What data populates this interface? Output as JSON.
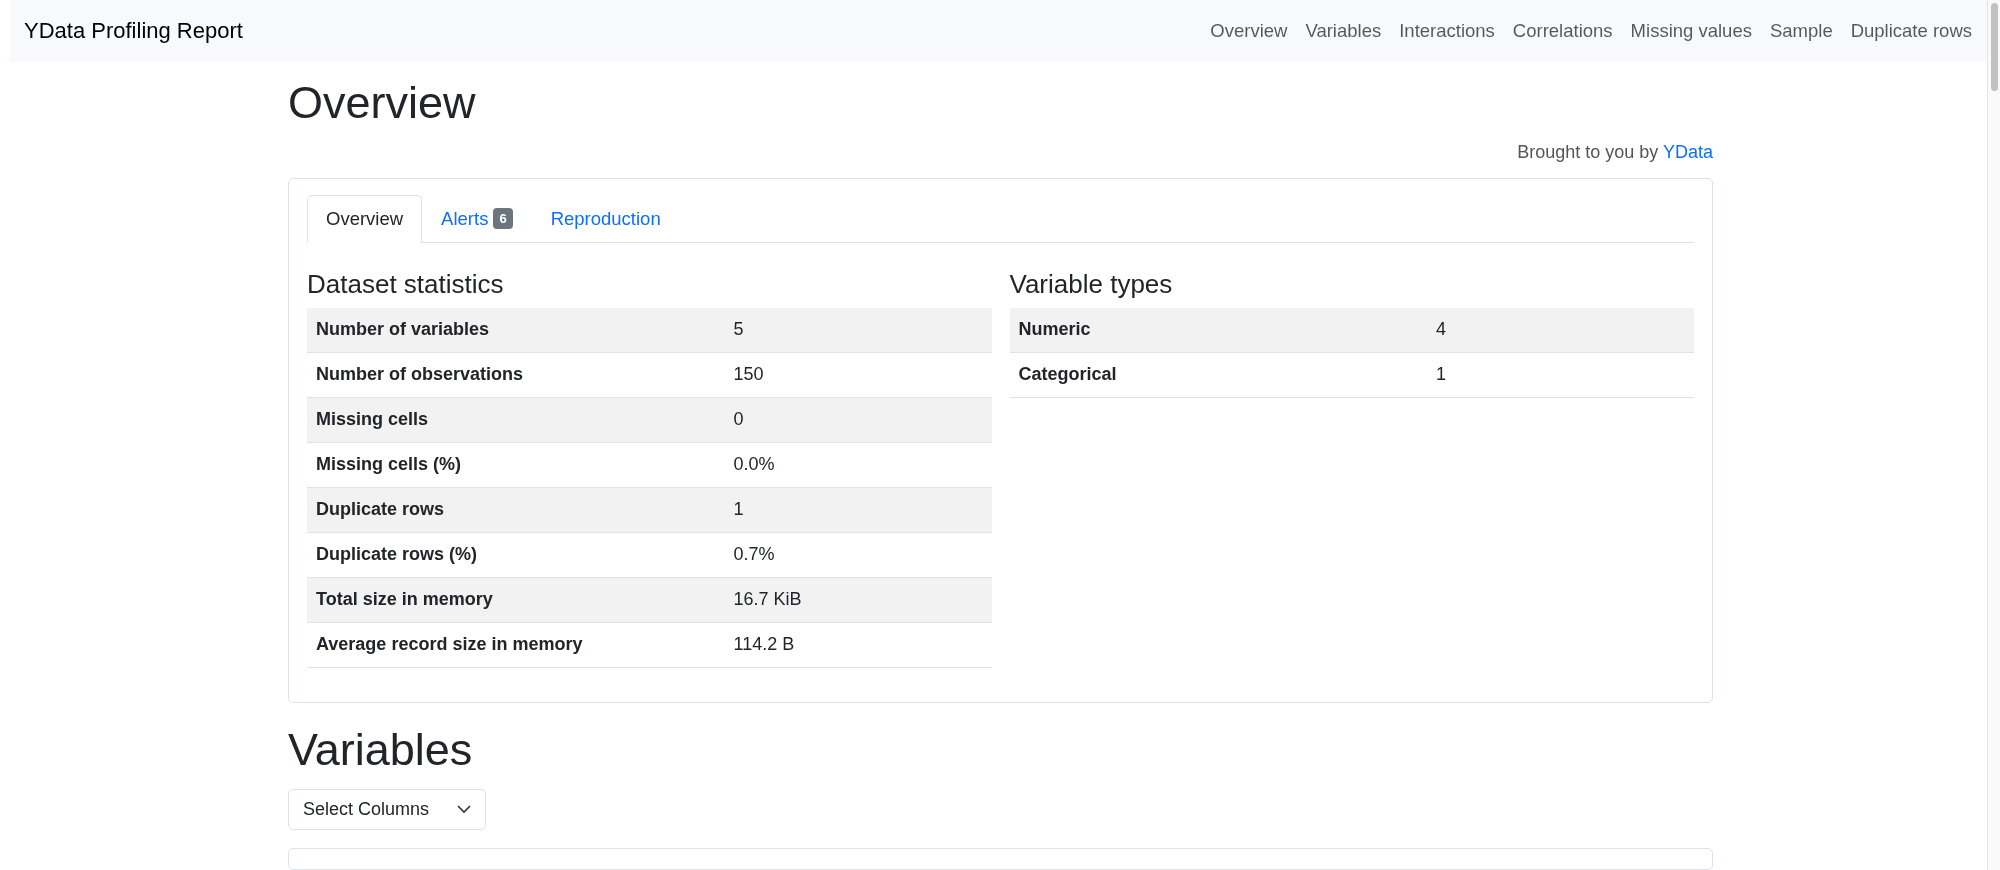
{
  "navbar": {
    "brand": "YData Profiling Report",
    "links": [
      "Overview",
      "Variables",
      "Interactions",
      "Correlations",
      "Missing values",
      "Sample",
      "Duplicate rows"
    ]
  },
  "overview": {
    "title": "Overview",
    "credit": {
      "text": "Brought to you by",
      "link": "YData"
    },
    "tabs": [
      {
        "label": "Overview",
        "selected": true
      },
      {
        "label": "Alerts",
        "badge": "6",
        "selected": false
      },
      {
        "label": "Reproduction",
        "selected": false
      }
    ],
    "dataset_statistics": {
      "title": "Dataset statistics",
      "rows": [
        {
          "label": "Number of variables",
          "value": "5"
        },
        {
          "label": "Number of observations",
          "value": "150"
        },
        {
          "label": "Missing cells",
          "value": "0"
        },
        {
          "label": "Missing cells (%)",
          "value": "0.0%"
        },
        {
          "label": "Duplicate rows",
          "value": "1"
        },
        {
          "label": "Duplicate rows (%)",
          "value": "0.7%"
        },
        {
          "label": "Total size in memory",
          "value": "16.7 KiB"
        },
        {
          "label": "Average record size in memory",
          "value": "114.2 B"
        }
      ]
    },
    "variable_types": {
      "title": "Variable types",
      "rows": [
        {
          "label": "Numeric",
          "value": "4"
        },
        {
          "label": "Categorical",
          "value": "1"
        }
      ]
    }
  },
  "variables": {
    "title": "Variables",
    "select": "Select Columns"
  }
}
